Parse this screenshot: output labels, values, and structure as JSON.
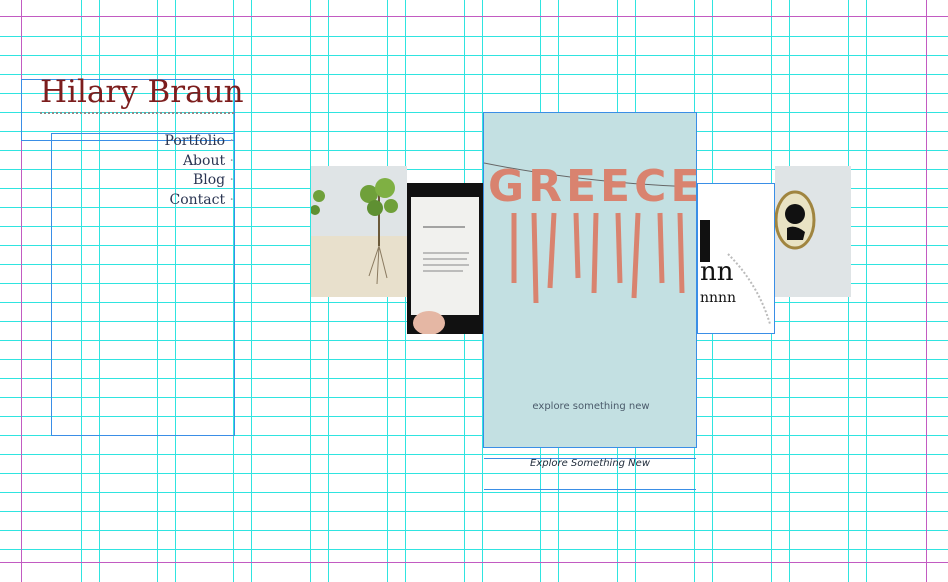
{
  "site": {
    "title": "Hilary Braun"
  },
  "nav": {
    "items": [
      {
        "label": "Portfolio"
      },
      {
        "label": "About"
      },
      {
        "label": "Blog"
      },
      {
        "label": "Contact"
      }
    ]
  },
  "carousel": {
    "featured": {
      "image_text": "GREECE",
      "tagline": "explore something new",
      "caption": "Explore Something New"
    },
    "thumbnails": [
      {
        "icon": "tree-illustration-icon"
      },
      {
        "icon": "book-page-icon"
      },
      {
        "icon": "typography-poster-icon"
      },
      {
        "icon": "cameo-portrait-icon"
      }
    ]
  },
  "colors": {
    "title": "#7c1d1d",
    "nav_text": "#2b3552",
    "guides": "#2fe4e0",
    "margins": "#c25bc2",
    "boxes": "#3a8ee6",
    "featured_bg": "#c3e0e2",
    "greece_text": "#d9836f"
  }
}
